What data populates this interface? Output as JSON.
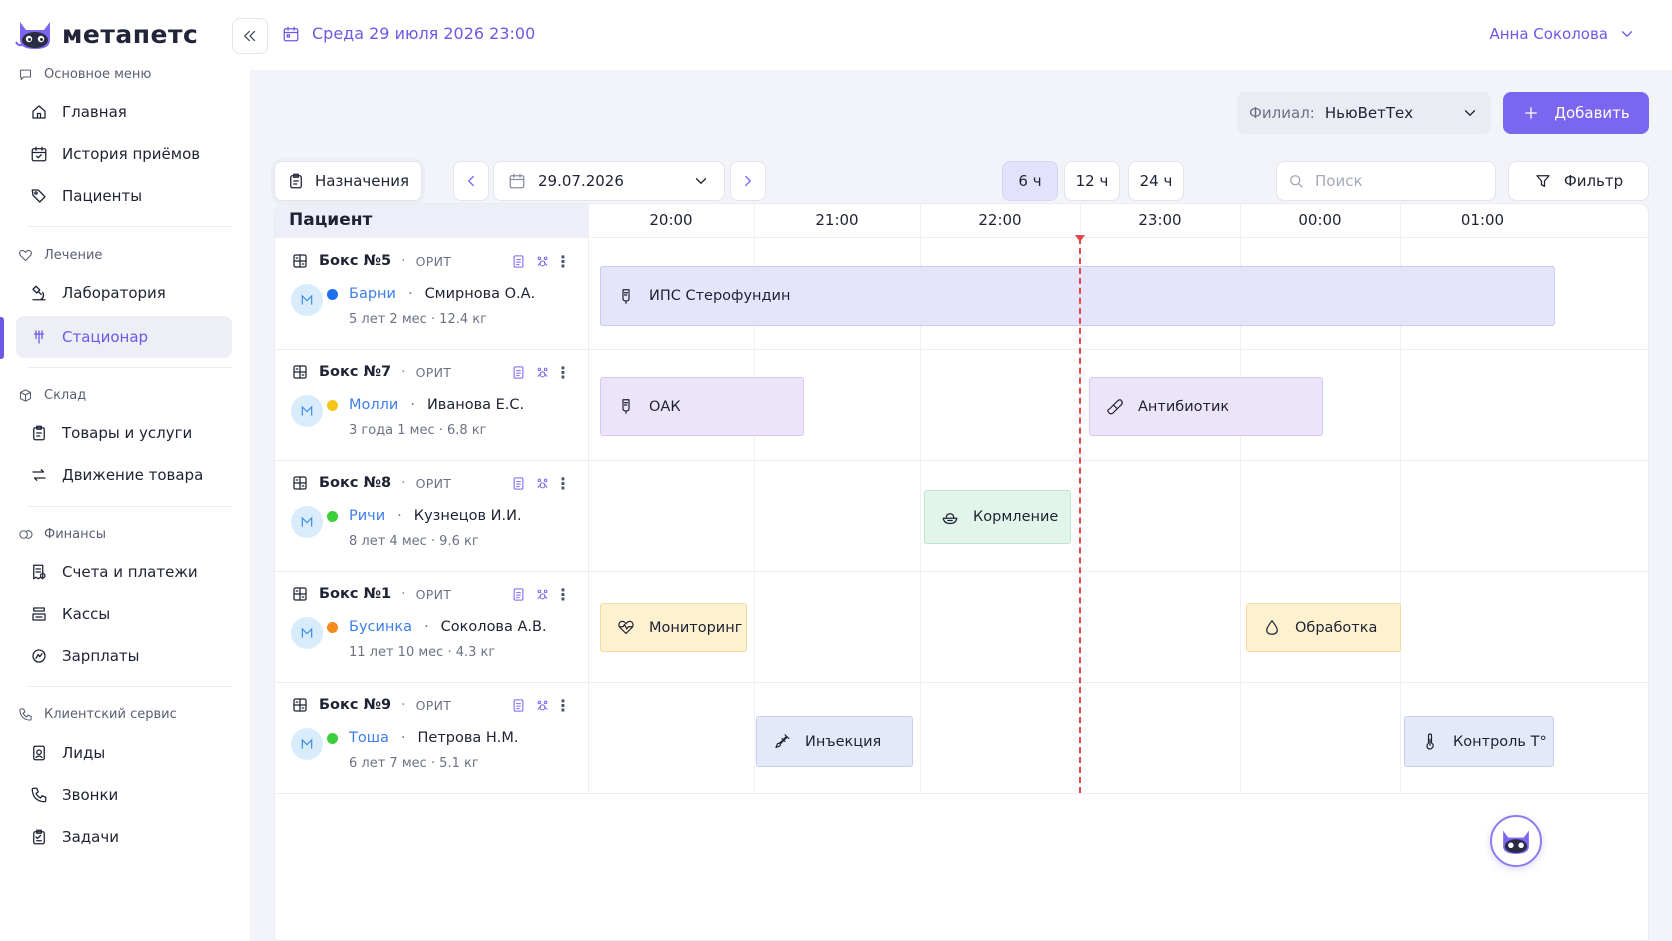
{
  "brand": {
    "name": "метапетс"
  },
  "header": {
    "datetime": "Среда 29 июля 2026 23:00",
    "user": "Анна Соколова"
  },
  "sidebar": {
    "sections": [
      {
        "title": "Основное меню",
        "items": [
          "Главная",
          "История приёмов",
          "Пациенты"
        ]
      },
      {
        "title": "Лечение",
        "items": [
          "Лаборатория",
          "Стационар"
        ]
      },
      {
        "title": "Склад",
        "items": [
          "Товары и услуги",
          "Движение товара"
        ]
      },
      {
        "title": "Финансы",
        "items": [
          "Счета и платежи",
          "Кассы",
          "Зарплаты"
        ]
      },
      {
        "title": "Клиентский сервис",
        "items": [
          "Лиды",
          "Звонки",
          "Задачи"
        ]
      }
    ],
    "active_item": "Стационар"
  },
  "branch": {
    "label": "Филиал:",
    "value": "НьюВетТех"
  },
  "add_button": {
    "label": "Добавить"
  },
  "toolbar": {
    "appointments_label": "Назначения",
    "date": "29.07.2026",
    "ranges": [
      "6 ч",
      "12 ч",
      "24 ч"
    ],
    "selected_range": "6 ч",
    "search_placeholder": "Поиск",
    "filter_label": "Фильтр"
  },
  "schedule": {
    "patient_header": "Пациент",
    "hours": [
      "20:00",
      "21:00",
      "22:00",
      "23:00",
      "00:00",
      "01:00"
    ],
    "current_time": "23:00",
    "rows": [
      {
        "box": "Бокс №5",
        "dept": "ОРИТ",
        "pet": "Барни",
        "owner": "Смирнова О.А.",
        "meta": "5 лет 2 мес · 12.4 кг",
        "status_color": "#1e6ff0"
      },
      {
        "box": "Бокс №7",
        "dept": "ОРИТ",
        "pet": "Молли",
        "owner": "Иванова Е.С.",
        "meta": "3 года 1 мес · 6.8 кг",
        "status_color": "#f5c518"
      },
      {
        "box": "Бокс №8",
        "dept": "ОРИТ",
        "pet": "Ричи",
        "owner": "Кузнецов И.И.",
        "meta": "8 лет 4 мес · 9.6 кг",
        "status_color": "#3ccf3c"
      },
      {
        "box": "Бокс №1",
        "dept": "ОРИТ",
        "pet": "Бусинка",
        "owner": "Соколова А.В.",
        "meta": "11 лет 10 мес · 4.3 кг",
        "status_color": "#f58a1f"
      },
      {
        "box": "Бокс №9",
        "dept": "ОРИТ",
        "pet": "Тоша",
        "owner": "Петрова Н.М.",
        "meta": "6 лет 7 мес · 5.1 кг",
        "status_color": "#3ccf3c"
      }
    ],
    "events": [
      {
        "row": 0,
        "title": "ИПС Стерофундин",
        "icon": "iv-bag-icon",
        "start": "20:00",
        "end": "01:00+",
        "color": "#e4e5fa",
        "border": "#c9cbf2"
      },
      {
        "row": 1,
        "title": "ОАК",
        "icon": "iv-bag-icon",
        "start": "20:00",
        "end": "21:15",
        "color": "#ece4fa",
        "border": "#d6c9f2"
      },
      {
        "row": 1,
        "title": "Антибиотик",
        "icon": "pill-icon",
        "start": "23:00",
        "end": "00:30",
        "color": "#ece4fa",
        "border": "#d6c9f2"
      },
      {
        "row": 2,
        "title": "Кормление",
        "icon": "bowl-icon",
        "start": "22:00",
        "end": "23:00",
        "color": "#e2f5ea",
        "border": "#bfe6cd"
      },
      {
        "row": 3,
        "title": "Мониторинг",
        "icon": "heart-monitor-icon",
        "start": "20:00",
        "end": "21:00",
        "color": "#fdf1cf",
        "border": "#f1dc9d"
      },
      {
        "row": 3,
        "title": "Обработка",
        "icon": "drop-icon",
        "start": "00:00",
        "end": "01:00",
        "color": "#fdf1cf",
        "border": "#f1dc9d"
      },
      {
        "row": 4,
        "title": "Инъекция",
        "icon": "syringe-icon",
        "start": "21:00",
        "end": "22:00",
        "color": "#e4e8f8",
        "border": "#c6cdef"
      },
      {
        "row": 4,
        "title": "Контроль T°",
        "icon": "thermometer-icon",
        "start": "01:00",
        "end": "02:00",
        "color": "#e4e8f8",
        "border": "#c6cdef"
      }
    ]
  },
  "colors": {
    "accent": "#7b66f0",
    "link": "#3d7ee8",
    "now_line": "#e54848"
  }
}
